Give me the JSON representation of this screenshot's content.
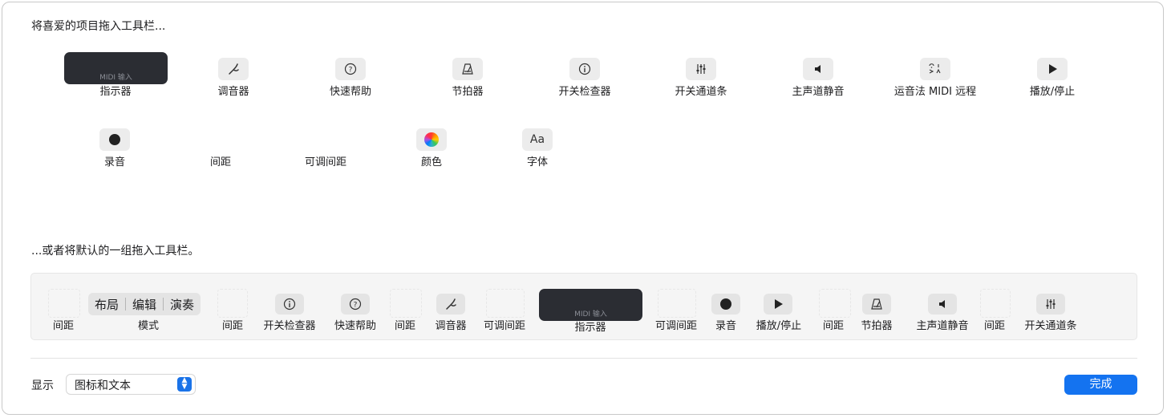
{
  "heading_top": "将喜爱的项目拖入工具栏...",
  "heading_bottom": "...或者将默认的一组拖入工具栏。",
  "palette_row1": [
    {
      "label": "指示器",
      "icon": "lcd-display-icon",
      "lcd_text": "MIDI 输入"
    },
    {
      "label": "调音器",
      "icon": "tuning-fork-icon"
    },
    {
      "label": "快速帮助",
      "icon": "question-mark-icon"
    },
    {
      "label": "节拍器",
      "icon": "metronome-icon"
    },
    {
      "label": "开关检查器",
      "icon": "info-icon"
    },
    {
      "label": "开关通道条",
      "icon": "sliders-icon"
    },
    {
      "label": "主声道静音",
      "icon": "speaker-icon"
    },
    {
      "label": "运音法 MIDI 远程",
      "icon": "articulation-icon"
    },
    {
      "label": "播放/停止",
      "icon": "play-icon"
    }
  ],
  "palette_row2": [
    {
      "label": "录音",
      "icon": "record-icon"
    },
    {
      "label": "间距",
      "icon": "spacer-icon"
    },
    {
      "label": "可调间距",
      "icon": "flexible-spacer-icon"
    },
    {
      "label": "颜色",
      "icon": "color-wheel-icon"
    },
    {
      "label": "字体",
      "icon": "font-icon",
      "icon_text": "Aa"
    }
  ],
  "default_set": {
    "mode_segments": [
      "布局",
      "编辑",
      "演奏"
    ],
    "lcd_text": "MIDI 输入",
    "labels": [
      "间距",
      "模式",
      "间距",
      "开关检查器",
      "快速帮助",
      "间距",
      "调音器",
      "可调间距",
      "指示器",
      "可调间距",
      "录音",
      "播放/停止",
      "间距",
      "节拍器",
      "主声道静音",
      "间距",
      "开关通道条"
    ]
  },
  "footer": {
    "show_label": "显示",
    "show_value": "图标和文本",
    "done_label": "完成"
  },
  "colors": {
    "accent": "#1473f0",
    "lcd": "#2b2d33",
    "icon_bg": "#ececec"
  }
}
